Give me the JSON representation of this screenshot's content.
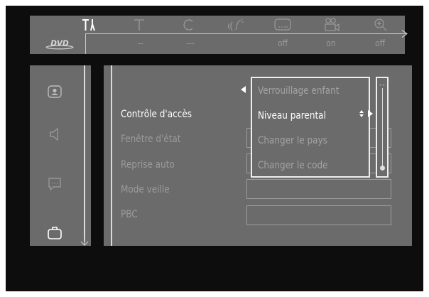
{
  "top_icons": [
    {
      "name": "setup-icon",
      "active": true
    },
    {
      "name": "title-icon",
      "active": false
    },
    {
      "name": "chapter-icon",
      "active": false
    },
    {
      "name": "audio-icon",
      "active": false
    },
    {
      "name": "subtitle-icon",
      "active": false
    },
    {
      "name": "angle-icon",
      "active": false
    },
    {
      "name": "zoom-icon",
      "active": false
    }
  ],
  "disc_logo_text": "DVD",
  "top_values": [
    "--",
    "---",
    "off",
    "on",
    "off"
  ],
  "nav_icons": [
    "picture-settings-icon",
    "sound-settings-icon",
    "language-settings-icon",
    "features-icon"
  ],
  "menu": {
    "items": [
      {
        "label": "Contrôle d'accès",
        "active": true
      },
      {
        "label": "Fenêtre d'état",
        "active": false
      },
      {
        "label": "Reprise auto",
        "active": false
      },
      {
        "label": "Mode veille",
        "active": false
      },
      {
        "label": "PBC",
        "active": false
      }
    ]
  },
  "submenu": {
    "items": [
      {
        "label": "Verrouillage enfant",
        "active": false
      },
      {
        "label": "Niveau parental",
        "active": true
      },
      {
        "label": "Changer le pays",
        "active": false
      },
      {
        "label": "Changer le code",
        "active": false
      }
    ]
  },
  "slider": {
    "top_label": "--",
    "level_fraction": 1.0
  },
  "colors": {
    "panel": "#6b6b6b",
    "highlight": "#ffffff",
    "dim_text": "#9b9b9b",
    "screen": "#0d0d0d"
  }
}
